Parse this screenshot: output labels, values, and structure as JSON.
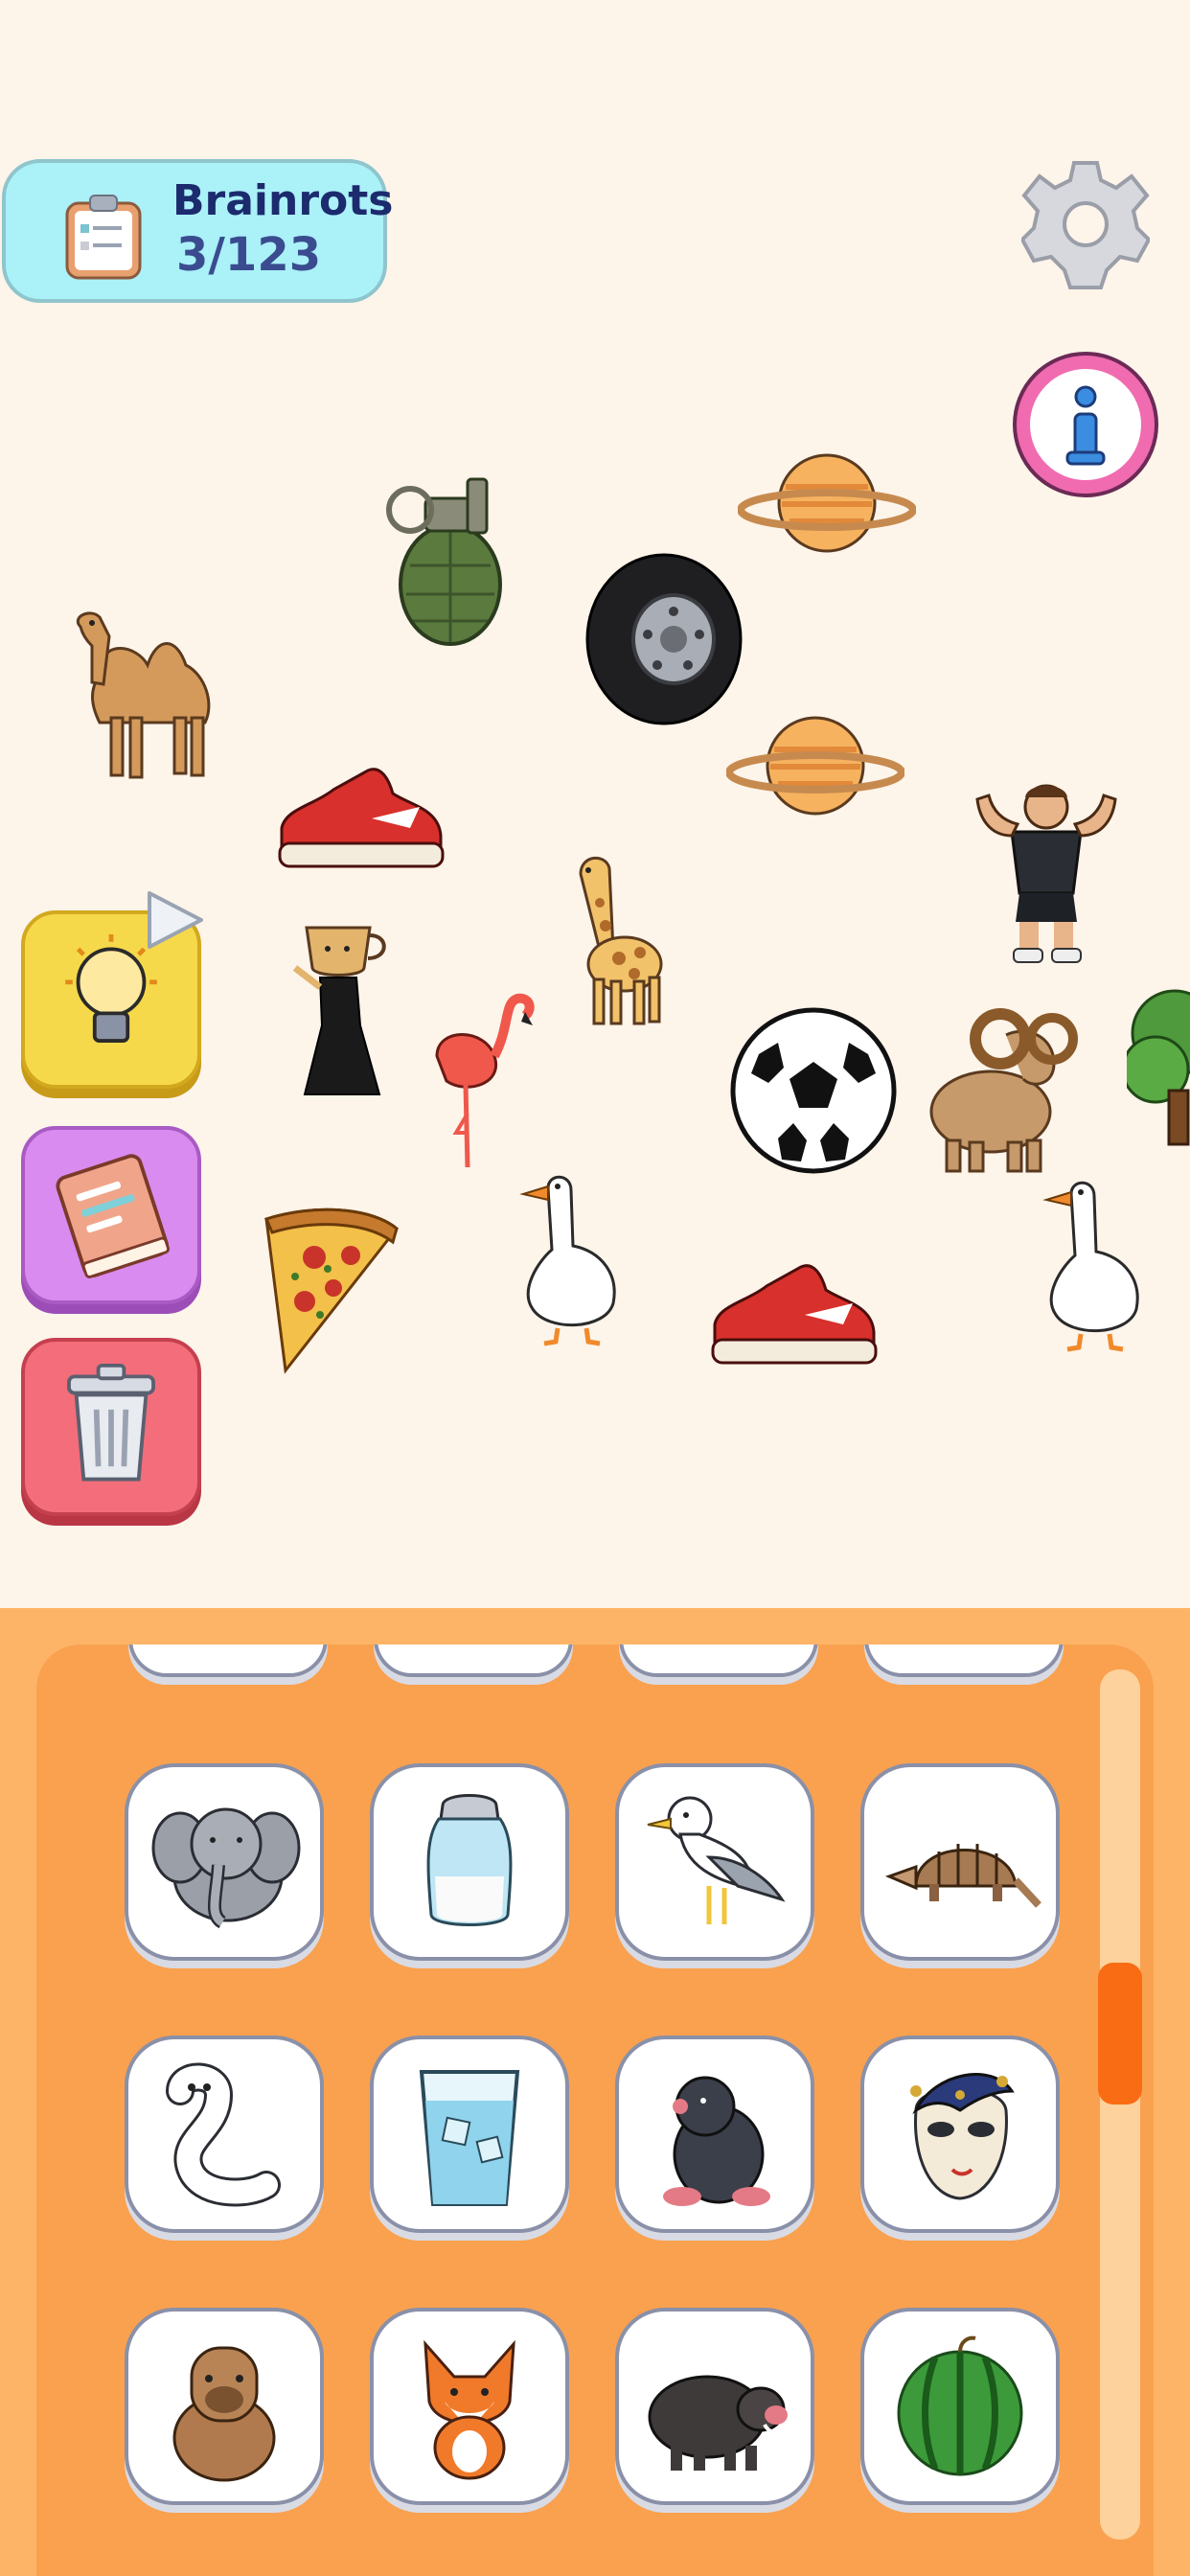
{
  "counter": {
    "title": "Brainrots",
    "count": "3/123",
    "icon": "clipboard-icon"
  },
  "top_buttons": {
    "settings_icon": "gear-icon",
    "info_icon": "info-icon"
  },
  "board_items": [
    "camel",
    "grenade",
    "tire",
    "planet",
    "planet",
    "sneaker",
    "giraffe",
    "bodybuilder",
    "coffee-cup-lady",
    "flamingo",
    "soccer-ball",
    "ram",
    "tree",
    "pizza-slice",
    "goose",
    "sneaker",
    "goose"
  ],
  "side_buttons": {
    "hint_icon": "lightbulb-icon",
    "hint_badge_icon": "play-icon",
    "book_icon": "book-icon",
    "trash_icon": "trash-icon"
  },
  "inventory": {
    "rows": [
      [
        "elephant",
        "salt-shaker",
        "seagull",
        "armadillo"
      ],
      [
        "worm",
        "glass-of-water",
        "mole",
        "carnival-mask"
      ],
      [
        "capybara",
        "fox",
        "boar",
        "watermelon"
      ]
    ],
    "scroll_position": 0.35
  },
  "colors": {
    "board_bg": "#fdf4ea",
    "tray_bg": "#fdb466",
    "tray_inner": "#f9a14f",
    "counter_bg": "#aaf1f8",
    "scroll_thumb": "#f96c14"
  }
}
